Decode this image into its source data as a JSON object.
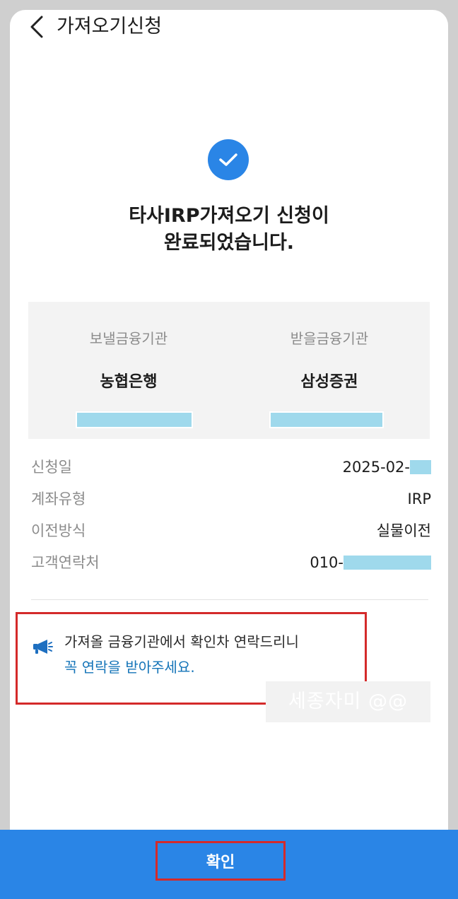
{
  "header": {
    "title": "가져오기신청",
    "back_icon": "chevron-left-icon"
  },
  "result": {
    "status_icon": "check-circle-icon",
    "title_line1": "타사IRP가져오기 신청이",
    "title_line2": "완료되었습니다."
  },
  "institutions": {
    "sending_label": "보낼금융기관",
    "sending_name": "농협은행",
    "receiving_label": "받을금융기관",
    "receiving_name": "삼성증권"
  },
  "details": [
    {
      "label": "신청일",
      "value": "2025-02-"
    },
    {
      "label": "계좌유형",
      "value": "IRP"
    },
    {
      "label": "이전방식",
      "value": "실물이전"
    },
    {
      "label": "고객연락처",
      "value": "010-"
    }
  ],
  "notice": {
    "icon": "megaphone-icon",
    "line1": "가져올 금융기관에서 확인차 연락드리니",
    "line2": "꼭 연락을 받아주세요."
  },
  "watermark": "세종자미 @@",
  "footer": {
    "confirm_label": "확인"
  },
  "colors": {
    "primary": "#2a85e6",
    "link": "#1474b8",
    "highlight_border": "#d42a2a",
    "redaction": "#9fd9ec"
  }
}
